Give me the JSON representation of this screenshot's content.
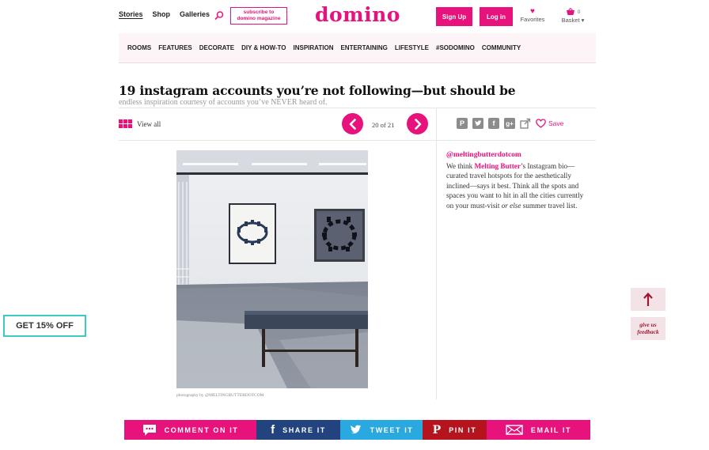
{
  "colors": {
    "brand": "#e8127c",
    "promo_border": "#3ec9c2",
    "facebook": "#23437e",
    "twitter": "#29a9e0",
    "pinterest": "#b5141e"
  },
  "header": {
    "nav": [
      "Stories",
      "Shop",
      "Galleries"
    ],
    "subscribe_line1": "subscribe to",
    "subscribe_line2": "domino magazine",
    "logo": "domino",
    "signup": "Sign Up",
    "login": "Log in",
    "favorites": "Favorites",
    "basket": "Basket ▾",
    "basket_count": "0"
  },
  "categories": [
    "ROOMS",
    "FEATURES",
    "DECORATE",
    "DIY & HOW-TO",
    "INSPIRATION",
    "ENTERTAINING",
    "LIFESTYLE",
    "#SODOMINO",
    "COMMUNITY"
  ],
  "article": {
    "title": "19 instagram accounts you’re not following—but should be",
    "subtitle": "endless inspiration courtesy of accounts you’ve NEVER heard of."
  },
  "toolbar": {
    "view_all": "View all",
    "counter": "20 of 21",
    "save": "Save"
  },
  "slide": {
    "credit": "photography by @MELTINGBUTTERDOTCOM",
    "handle": "@meltingbutterdotcom",
    "body_pre": "We think ",
    "body_link": "Melting Butter",
    "body_mid": "’s Instagram bio—curated travel hotspots for the aesthetically inclined—says it best. Think all the spots and spaces you want to hit in all the cities currently on your must-visit ",
    "body_em": "or else",
    "body_post": " summer travel list."
  },
  "promo": "GET 15% OFF",
  "feedback": [
    "give us",
    "feedback"
  ],
  "sharebar": {
    "comment": "COMMENT ON IT",
    "share": "SHARE IT",
    "tweet": "TWEET IT",
    "pin": "PIN IT",
    "email": "EMAIL IT"
  }
}
